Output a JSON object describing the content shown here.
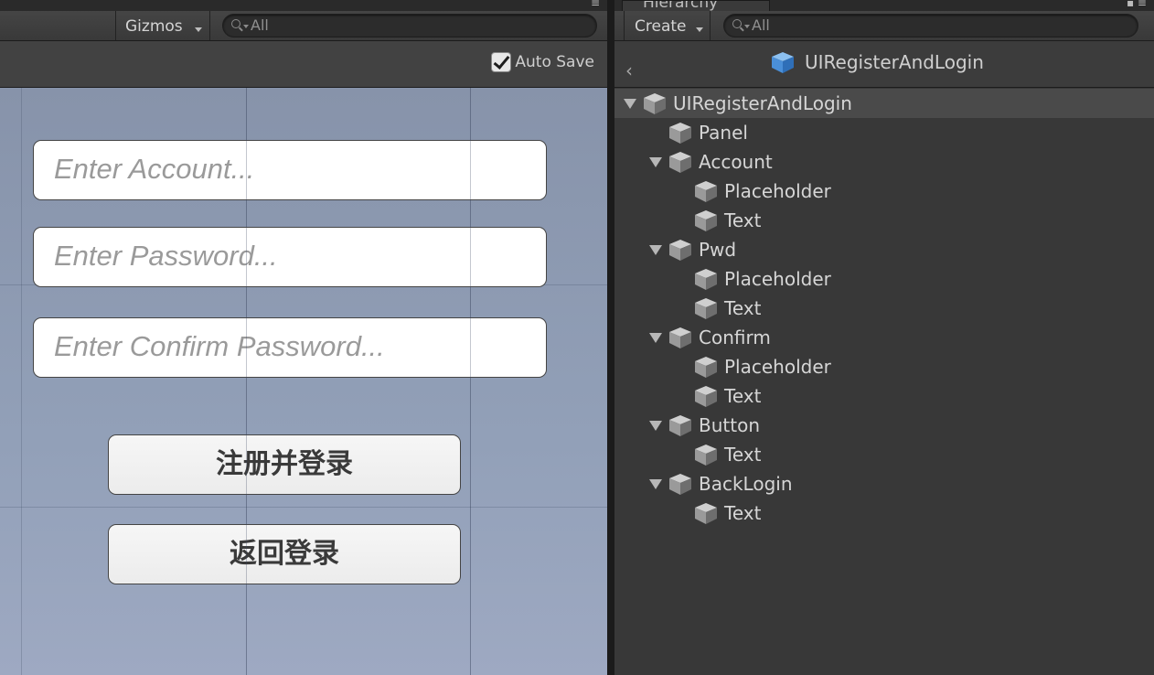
{
  "scene": {
    "gizmos_label": "Gizmos",
    "search_placeholder": "All",
    "autosave_label": "Auto Save",
    "autosave_checked": true,
    "inputs": [
      {
        "placeholder": "Enter Account..."
      },
      {
        "placeholder": "Enter Password..."
      },
      {
        "placeholder": "Enter Confirm Password..."
      }
    ],
    "buttons": [
      {
        "label": "注册并登录"
      },
      {
        "label": "返回登录"
      }
    ]
  },
  "hierarchy": {
    "tab_label": "Hierarchy",
    "create_label": "Create",
    "search_placeholder": "All",
    "title": "UIRegisterAndLogin",
    "tree": [
      {
        "label": "UIRegisterAndLogin",
        "depth": 0,
        "expanded": true,
        "selected": true
      },
      {
        "label": "Panel",
        "depth": 1,
        "expanded": false
      },
      {
        "label": "Account",
        "depth": 1,
        "expanded": true
      },
      {
        "label": "Placeholder",
        "depth": 2,
        "expanded": false
      },
      {
        "label": "Text",
        "depth": 2,
        "expanded": false
      },
      {
        "label": "Pwd",
        "depth": 1,
        "expanded": true
      },
      {
        "label": "Placeholder",
        "depth": 2,
        "expanded": false
      },
      {
        "label": "Text",
        "depth": 2,
        "expanded": false
      },
      {
        "label": "Confirm",
        "depth": 1,
        "expanded": true
      },
      {
        "label": "Placeholder",
        "depth": 2,
        "expanded": false
      },
      {
        "label": "Text",
        "depth": 2,
        "expanded": false
      },
      {
        "label": "Button",
        "depth": 1,
        "expanded": true
      },
      {
        "label": "Text",
        "depth": 2,
        "expanded": false
      },
      {
        "label": "BackLogin",
        "depth": 1,
        "expanded": true
      },
      {
        "label": "Text",
        "depth": 2,
        "expanded": false
      }
    ]
  },
  "colors": {
    "viewport_bg": "#8f9bb3",
    "panel_bg": "#383838",
    "prefab_icon": "#4a8fd8"
  }
}
